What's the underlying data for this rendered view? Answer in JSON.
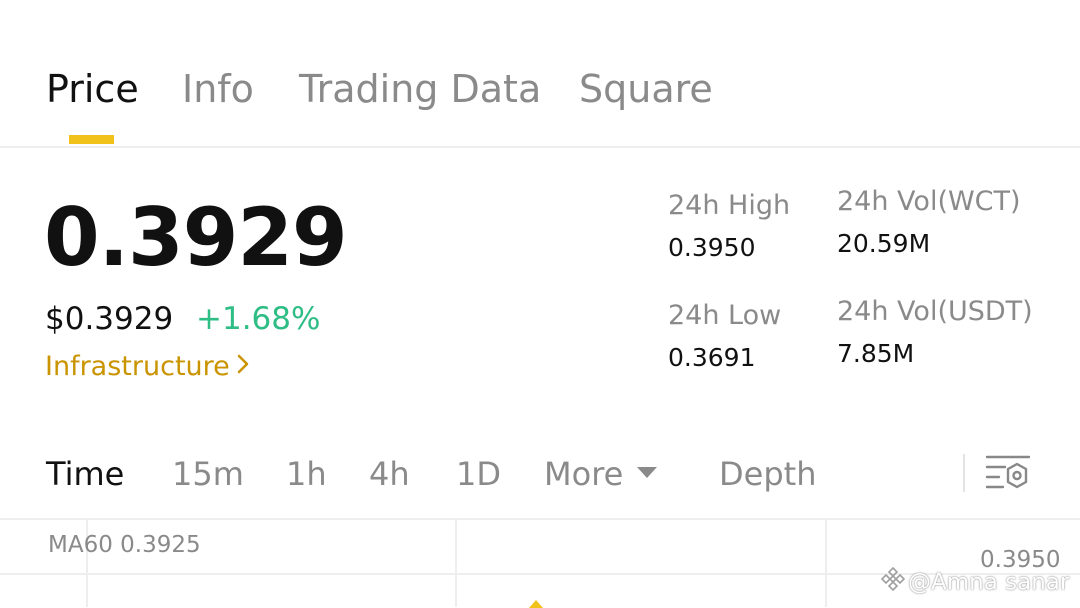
{
  "tabs": [
    {
      "label": "Price",
      "active": true
    },
    {
      "label": "Info",
      "active": false
    },
    {
      "label": "Trading Data",
      "active": false
    },
    {
      "label": "Square",
      "active": false
    }
  ],
  "price": {
    "last": "0.3929",
    "usd": "$0.3929",
    "change": "+1.68%",
    "category": "Infrastructure",
    "change_color": "#2ebd85",
    "category_color": "#c99400"
  },
  "stats": {
    "high_label": "24h High",
    "high_value": "0.3950",
    "low_label": "24h Low",
    "low_value": "0.3691",
    "vol_base_label": "24h Vol(WCT)",
    "vol_base_value": "20.59M",
    "vol_quote_label": "24h Vol(USDT)",
    "vol_quote_value": "7.85M"
  },
  "timeframes": {
    "time": "Time",
    "m15": "15m",
    "h1": "1h",
    "h4": "4h",
    "d1": "1D",
    "more": "More",
    "depth": "Depth",
    "active": "Time"
  },
  "chart": {
    "ma_label": "MA60 0.3925",
    "axis_top": "0.3950",
    "accent_color": "#f0c21a"
  },
  "watermark": "@Amna sanar",
  "icons": {
    "more_caret": "caret-down-icon",
    "settings": "chart-settings-icon",
    "category_chevron": "chevron-right-icon"
  }
}
